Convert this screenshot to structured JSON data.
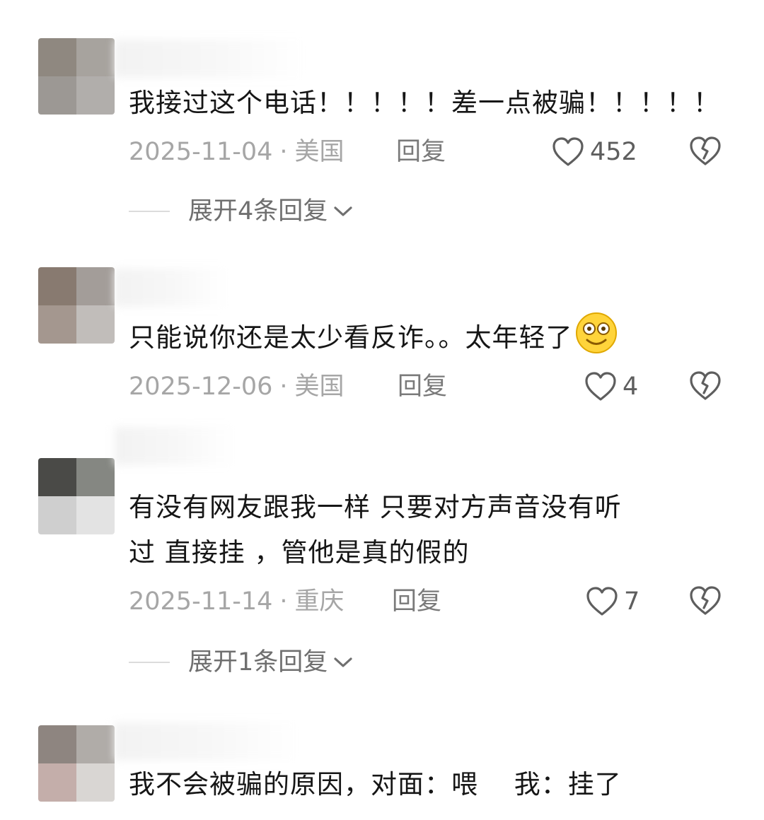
{
  "comments": [
    {
      "text": "我接过这个电话！！！！！差一点被骗！！！！！",
      "date": "2025-11-04",
      "location": "美国",
      "reply_label": "回复",
      "likes": "452",
      "expand_label": "展开4条回复"
    },
    {
      "text": "只能说你还是太少看反诈。。太年轻了",
      "emoji": "smile-emoji-icon",
      "date": "2025-12-06",
      "location": "美国",
      "reply_label": "回复",
      "likes": "4"
    },
    {
      "text_line1": "有没有网友跟我一样 只要对方声音没有听",
      "text_line2": "过 直接挂 ，管他是真的假的",
      "date": "2025-11-14",
      "location": "重庆",
      "reply_label": "回复",
      "likes": "7",
      "expand_label": "展开1条回复"
    },
    {
      "text": "我不会被骗的原因，对面：喂　 我：挂了"
    }
  ],
  "separator": "·",
  "colors": {
    "text": "#161616",
    "meta": "#a6a6a6",
    "reply": "#7a7a7a",
    "icon": "#5e5e5e"
  }
}
